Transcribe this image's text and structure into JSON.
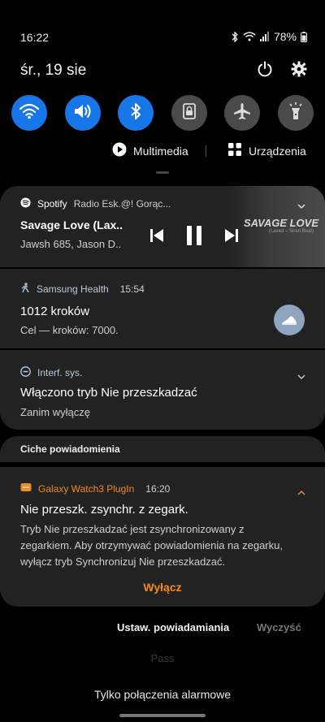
{
  "status_bar": {
    "time": "16:22",
    "battery": "78%"
  },
  "header": {
    "date": "śr., 19 sie"
  },
  "quick_settings": [
    {
      "name": "wifi",
      "state": "on"
    },
    {
      "name": "sound",
      "state": "on"
    },
    {
      "name": "bluetooth",
      "state": "on"
    },
    {
      "name": "lock-rotation",
      "state": "off"
    },
    {
      "name": "airplane",
      "state": "off"
    },
    {
      "name": "flashlight",
      "state": "off"
    }
  ],
  "media": {
    "multimedia_label": "Multimedia",
    "devices_label": "Urządzenia"
  },
  "notifications": {
    "spotify": {
      "app": "Spotify",
      "subtitle": "Radio Esk.@! Gorąc...",
      "title": "Savage Love (Lax..",
      "artist": "Jawsh 685, Jason D..",
      "album_title": "SAVAGE LOVE",
      "album_sub": "(Laxed – Siren Beat)"
    },
    "health": {
      "app": "Samsung Health",
      "time": "15:54",
      "title": "1012 kroków",
      "text": "Cel — kroków: 7000."
    },
    "interf": {
      "app": "Interf. sys.",
      "title": "Włączono tryb Nie przeszkadzać",
      "text": "Zanim wyłączę"
    },
    "silent_header": "Ciche powiadomienia",
    "watch": {
      "app": "Galaxy Watch3 PlugIn",
      "time": "16:20",
      "title": "Nie przeszk. zsynchr. z zegark.",
      "text_line1": "Tryb Nie przeszkadzać jest zsynchronizowany z",
      "text_line2": "zegarkiem. Aby otrzymywać powiadomienia na zegarku,",
      "text_line3": "wyłącz tryb Synchronizuj Nie przeszkadzać.",
      "action": "Wyłącz"
    }
  },
  "footer": {
    "settings": "Ustaw. powiadamiania",
    "clear": "Wyczyść",
    "ghost": "Pass",
    "emergency": "Tylko połączenia alarmowe"
  },
  "colors": {
    "accent": "#1877e8",
    "warning": "#f08a24"
  }
}
